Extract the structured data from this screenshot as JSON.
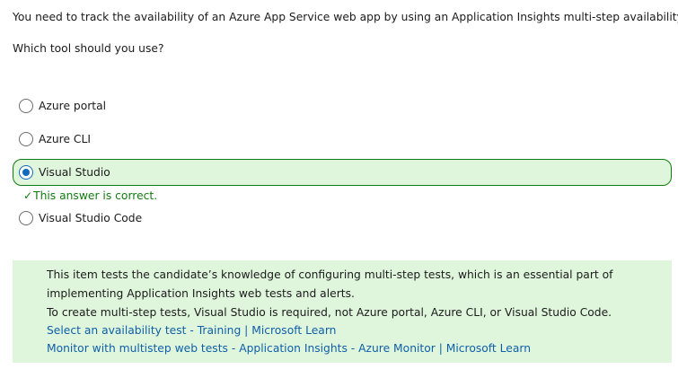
{
  "question": {
    "stem": "You need to track the availability of an Azure App Service web app by using an Application Insights multi-step availability test.",
    "prompt": "Which tool should you use?"
  },
  "options": [
    {
      "label": "Azure portal",
      "selected": false
    },
    {
      "label": "Azure CLI",
      "selected": false
    },
    {
      "label": "Visual Studio",
      "selected": true
    },
    {
      "label": "Visual Studio Code",
      "selected": false
    }
  ],
  "feedback": {
    "icon": "checkmark-icon",
    "check": "✓",
    "text": "This answer is correct.",
    "color": "#107c10"
  },
  "explanation": {
    "lines": [
      "This item tests the candidate’s knowledge of configuring multi-step tests, which is an essential part of",
      "implementing Application Insights web tests and alerts.",
      "To create multi-step tests, Visual Studio is required, not Azure portal, Azure CLI, or Visual Studio Code."
    ],
    "links": [
      "Select an availability test - Training | Microsoft Learn",
      "Monitor with multistep web tests - Application Insights - Azure Monitor | Microsoft Learn"
    ],
    "background": "#dff6dd"
  },
  "colors": {
    "accent": "#0f6cbd",
    "success": "#107c10",
    "link": "#0f5fa8"
  }
}
